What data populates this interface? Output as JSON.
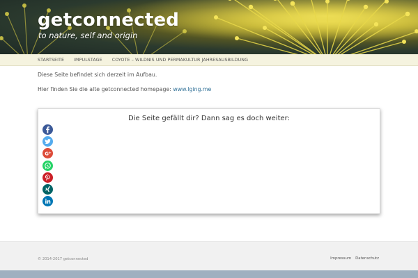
{
  "header": {
    "title": "getconnected",
    "tagline": "to nature, self and origin"
  },
  "nav": {
    "items": [
      {
        "label": "Startseite"
      },
      {
        "label": "Impulstage"
      },
      {
        "label": "Coyote – Wildnis und Permakultur Jahresausbildung"
      }
    ]
  },
  "content": {
    "line1": "Diese Seite befindet sich derzeit im Aufbau.",
    "line2_prefix": "Hier finden Sie die alte getconnected homepage: ",
    "line2_link": "www.lging.me"
  },
  "share": {
    "title": "Die Seite gefällt dir? Dann sag es doch weiter:",
    "icons": [
      {
        "name": "facebook-icon",
        "color": "#3b5998"
      },
      {
        "name": "twitter-icon",
        "color": "#55acee"
      },
      {
        "name": "google-plus-icon",
        "color": "#dd4b39"
      },
      {
        "name": "whatsapp-icon",
        "color": "#25d366"
      },
      {
        "name": "pinterest-icon",
        "color": "#cb2027"
      },
      {
        "name": "xing-icon",
        "color": "#026466"
      },
      {
        "name": "linkedin-icon",
        "color": "#0077b5"
      }
    ]
  },
  "footer": {
    "copyright": "© 2014-2017 getconnected",
    "links": [
      {
        "label": "Impressum"
      },
      {
        "label": "Datenschutz"
      }
    ]
  }
}
